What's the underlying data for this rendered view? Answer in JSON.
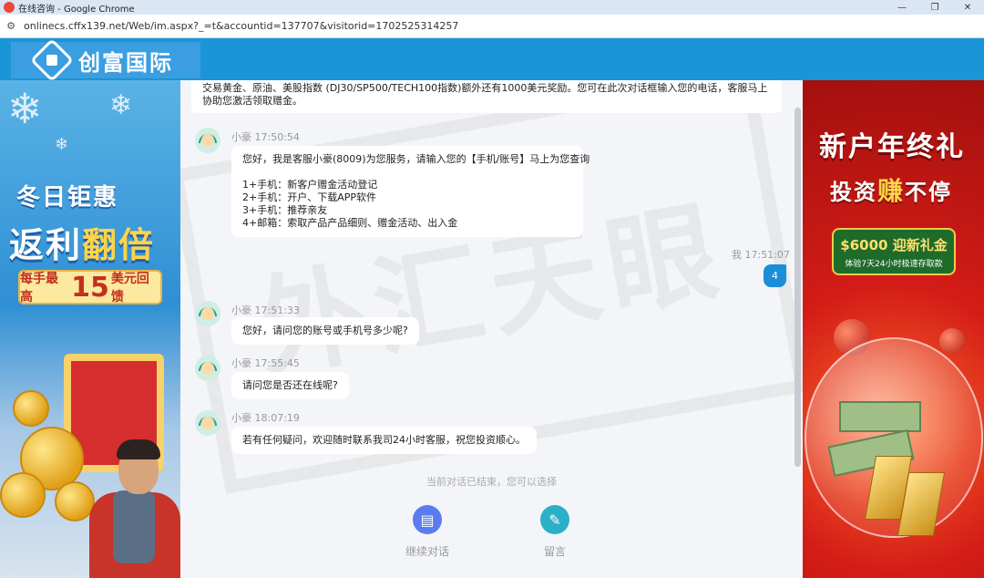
{
  "browser": {
    "window_title": "在线咨询 - Google Chrome",
    "url": "onlinecs.cffx139.net/Web/im.aspx?_=t&accountid=137707&visitorid=1702525314257",
    "minimize": "—",
    "restore": "❐",
    "close": "✕"
  },
  "header": {
    "brand": "创富国际"
  },
  "left_ad": {
    "line1": "冬日钜惠",
    "line2a": "返利",
    "line2b": "翻倍",
    "pill_a": "每手最高",
    "pill_num": "15",
    "pill_b": "美元回馈"
  },
  "right_ad": {
    "title": "新户年终礼",
    "sub_a": "投资",
    "sub_b": "赚",
    "sub_c": "不停",
    "badge_main": "$6000 迎新礼金",
    "badge_sub": "体验7天24小时极速存取款"
  },
  "chat": {
    "top_text": "交易黄金、原油、美股指数 (DJ30/SP500/TECH100指数)额外还有1000美元奖励。您可在此次对话框输入您的电话，客服马上协助您激活领取赠金。",
    "messages": [
      {
        "sender": "小豪",
        "time": "17:50:54",
        "lines": [
          "您好，我是客服小豪(8009)为您服务，请输入您的【手机/账号】马上为您查询",
          "",
          "1+手机：新客户赠金活动登记",
          "2+手机：开户、下载APP软件",
          "3+手机：推荐亲友",
          "4+邮箱：索取产品产品细则、赠金活动、出入金"
        ]
      },
      {
        "self_label": "我 17:51:07",
        "text": "4"
      },
      {
        "sender": "小豪",
        "time": "17:51:33",
        "text": "您好，请问您的账号或手机号多少呢?"
      },
      {
        "sender": "小豪",
        "time": "17:55:45",
        "text": "请问您是否还在线呢?"
      },
      {
        "sender": "小豪",
        "time": "18:07:19",
        "text": "若有任何疑问，欢迎随时联系我司24小时客服，祝您投资顺心。"
      }
    ],
    "ended_text": "当前对话已结束，您可以选择",
    "continue_label": "继续对话",
    "leave_msg_label": "留言"
  },
  "colors": {
    "header_blue": "#1a95d7",
    "self_bubble": "#1a8fd8",
    "continue_icon": "#5b7cf0",
    "leave_icon": "#2cb0c8"
  }
}
